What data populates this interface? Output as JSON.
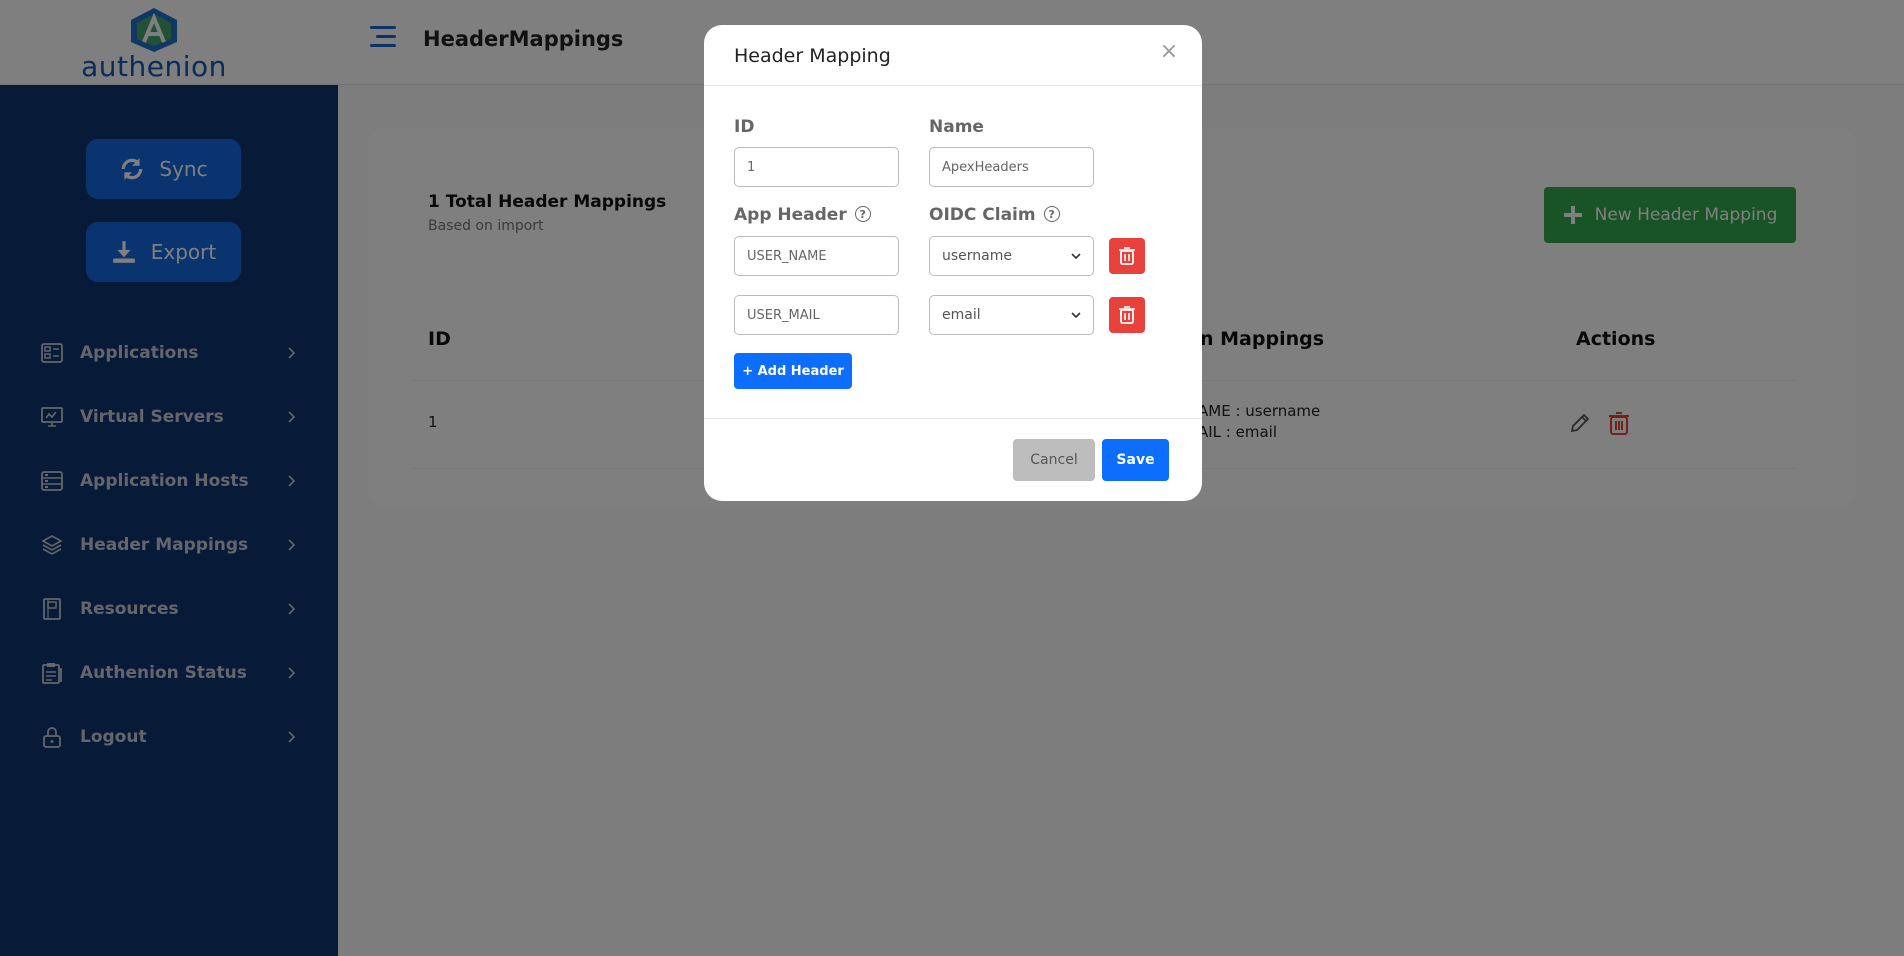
{
  "header": {
    "logo_text": "authenion",
    "page_title": "HeaderMappings"
  },
  "sidebar": {
    "sync_label": "Sync",
    "export_label": "Export",
    "items": [
      {
        "label": "Applications",
        "icon": "applications-icon"
      },
      {
        "label": "Virtual Servers",
        "icon": "monitor-icon"
      },
      {
        "label": "Application Hosts",
        "icon": "server-icon"
      },
      {
        "label": "Header Mappings",
        "icon": "layers-icon"
      },
      {
        "label": "Resources",
        "icon": "book-icon"
      },
      {
        "label": "Authenion Status",
        "icon": "clipboard-icon"
      },
      {
        "label": "Logout",
        "icon": "lock-icon"
      }
    ]
  },
  "main": {
    "total_label": "1 Total Header Mappings",
    "subtitle": "Based on import",
    "new_button_label": "New Header Mapping",
    "table": {
      "headers": [
        "ID",
        "n Mappings",
        "Actions"
      ],
      "rows": [
        {
          "id": "1",
          "mappings": [
            "AME : username",
            "AIL : email"
          ]
        }
      ]
    }
  },
  "modal": {
    "title": "Header Mapping",
    "close_symbol": "×",
    "id_label": "ID",
    "id_value": "1",
    "name_label": "Name",
    "name_value": "ApexHeaders",
    "app_header_label": "App Header",
    "oidc_claim_label": "OIDC Claim",
    "help_symbol": "?",
    "mappings": [
      {
        "header": "USER_NAME",
        "claim": "username"
      },
      {
        "header": "USER_MAIL",
        "claim": "email"
      }
    ],
    "add_header_label": "+ Add Header",
    "cancel_label": "Cancel",
    "save_label": "Save"
  },
  "colors": {
    "sidebar_bg": "#0f3673",
    "primary_blue": "#0d6efd",
    "success_green": "#30a84a",
    "danger_red": "#e8413c"
  }
}
